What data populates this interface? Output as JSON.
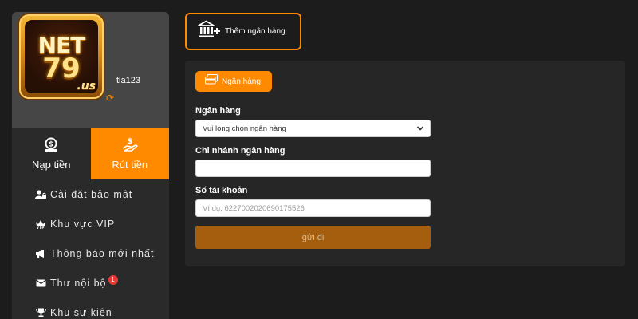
{
  "profile": {
    "logo_text": "NET79.us",
    "username": "tla123"
  },
  "wallet_tabs": {
    "deposit_label": "Nạp tiền",
    "withdraw_label": "Rút tiền"
  },
  "menu": {
    "items": [
      {
        "label": "Cài đặt bảo mật",
        "icon": "user-lock-icon"
      },
      {
        "label": "Khu vực VIP",
        "icon": "vip-crown-icon"
      },
      {
        "label": "Thông báo mới nhất",
        "icon": "megaphone-icon"
      },
      {
        "label": "Thư nội bộ",
        "icon": "envelope-icon",
        "badge": "1"
      },
      {
        "label": "Khu sự kiện",
        "icon": "trophy-icon"
      }
    ]
  },
  "add_bank": {
    "label": "Thêm ngân hàng"
  },
  "bank_form": {
    "tab_label": "Ngân hàng",
    "bank_label": "Ngân hàng",
    "bank_select_value": "Vui lòng chọn ngân hàng",
    "branch_label": "Chi nhánh ngân hàng",
    "branch_value": "",
    "account_label": "Số tài khoản",
    "account_placeholder": "Ví dụ: 6227002020690175526",
    "submit_label": "gửi đi"
  },
  "colors": {
    "accent": "#ff8a00",
    "background": "#1c1c1c",
    "panel": "#262626",
    "sidebar": "#2a2a2a",
    "profile_bg": "#464646",
    "submit_disabled": "#a55e0d",
    "badge": "#e53935"
  }
}
